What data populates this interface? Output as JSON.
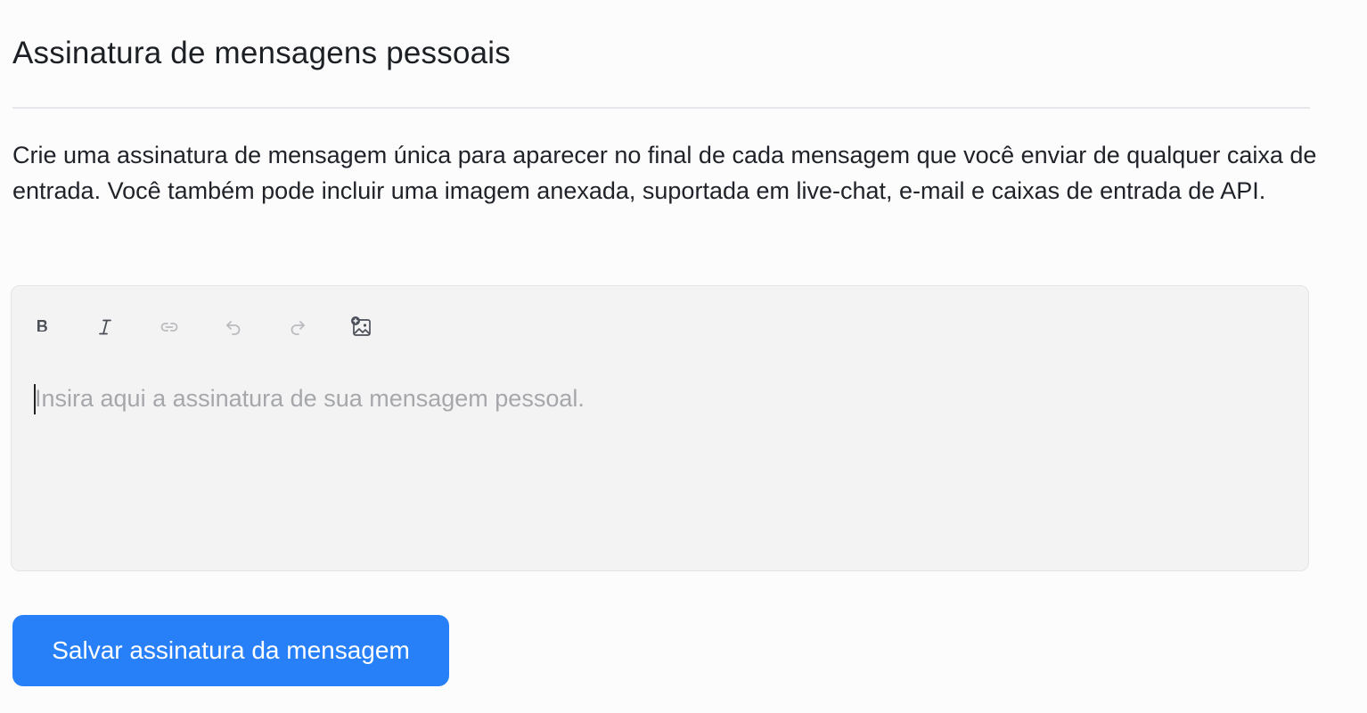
{
  "page": {
    "title": "Assinatura de mensagens pessoais",
    "description": "Crie uma assinatura de mensagem única para aparecer no final de cada mensagem que você enviar de qualquer caixa de entrada. Você também pode incluir uma imagem anexada, suportada em live-chat, e-mail e caixas de entrada de API."
  },
  "editor": {
    "toolbar": [
      {
        "name": "bold",
        "icon": "bold-icon",
        "enabled": true
      },
      {
        "name": "italic",
        "icon": "italic-icon",
        "enabled": true
      },
      {
        "name": "link",
        "icon": "link-icon",
        "enabled": false
      },
      {
        "name": "undo",
        "icon": "undo-icon",
        "enabled": false
      },
      {
        "name": "redo",
        "icon": "redo-icon",
        "enabled": false
      },
      {
        "name": "image",
        "icon": "image-add-icon",
        "enabled": true
      }
    ],
    "placeholder": "Insira aqui a assinatura de sua mensagem pessoal.",
    "value": ""
  },
  "actions": {
    "save_label": "Salvar assinatura da mensagem"
  },
  "colors": {
    "accent": "#2780f7",
    "background": "#fcfcfc",
    "editor_background": "#f3f3f3",
    "enabled_icon": "#4b4f58",
    "disabled_icon": "#b9bbbf",
    "placeholder": "#a6a7ab"
  }
}
